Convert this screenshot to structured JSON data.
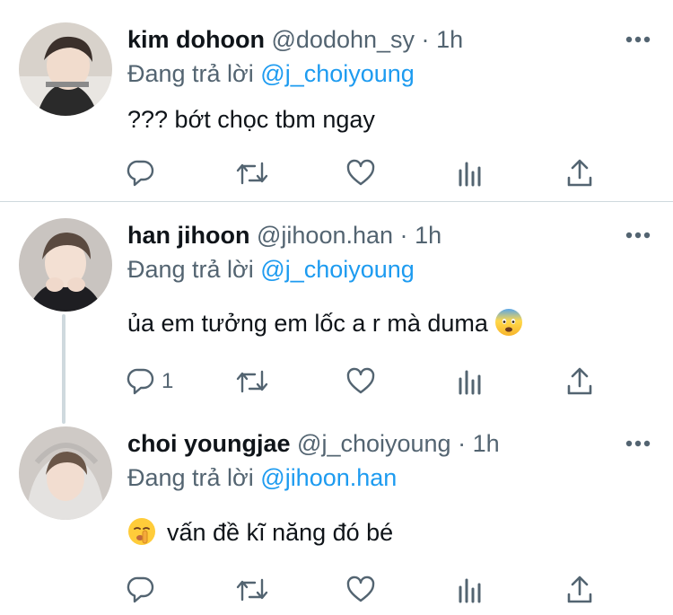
{
  "tweets": [
    {
      "name": "kim dohoon",
      "handle": "@dodohn_sy",
      "sep": "·",
      "time": "1h",
      "replying_prefix": "Đang trả lời",
      "replying_to": "@j_choiyoung",
      "text": "??? bớt chọc tbm ngay",
      "reply_count": ""
    },
    {
      "name": "han jihoon",
      "handle": "@jihoon.han",
      "sep": "·",
      "time": "1h",
      "replying_prefix": "Đang trả lời",
      "replying_to": "@j_choiyoung",
      "text": "ủa em tưởng em lốc a r mà duma",
      "reply_count": "1"
    },
    {
      "name": "choi youngjae",
      "handle": "@j_choiyoung",
      "sep": "·",
      "time": "1h",
      "replying_prefix": "Đang trả lời",
      "replying_to": "@jihoon.han",
      "text": "vấn đề kĩ năng đó bé",
      "reply_count": ""
    }
  ],
  "colors": {
    "text": "#0f1419",
    "secondary": "#536471",
    "link": "#1d9bf0",
    "divider": "#cfd9de"
  },
  "icons": [
    "reply-icon",
    "retweet-icon",
    "like-icon",
    "analytics-icon",
    "share-icon",
    "more-icon",
    "fearful-face-emoji",
    "shushing-face-emoji"
  ]
}
